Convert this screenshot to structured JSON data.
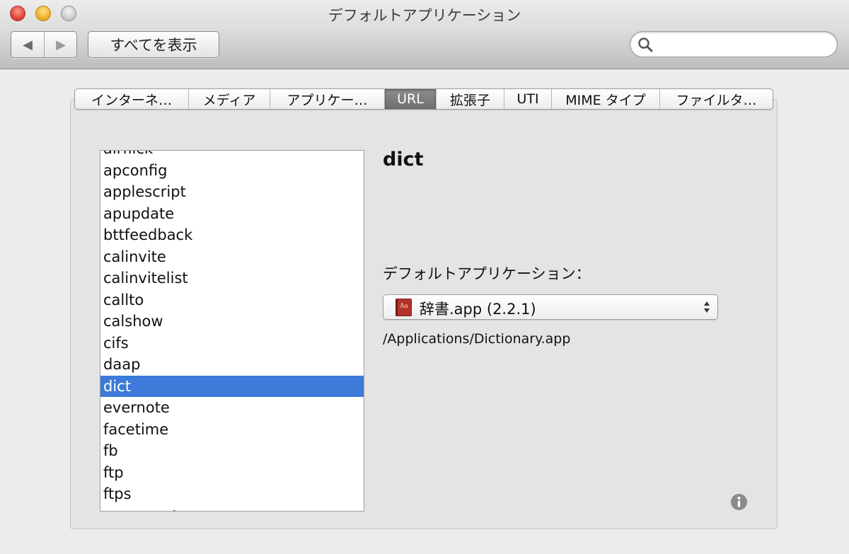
{
  "window": {
    "title": "デフォルトアプリケーション"
  },
  "toolbar": {
    "back_glyph": "◀",
    "forward_glyph": "▶",
    "show_all_label": "すべてを表示",
    "search": {
      "value": "",
      "placeholder": ""
    }
  },
  "tabs": [
    {
      "label": "インターネ…",
      "selected": false
    },
    {
      "label": "メディア",
      "selected": false
    },
    {
      "label": "アプリケー…",
      "selected": false
    },
    {
      "label": "URL",
      "selected": true
    },
    {
      "label": "拡張子",
      "selected": false
    },
    {
      "label": "UTI",
      "selected": false
    },
    {
      "label": "MIME タイプ",
      "selected": false
    },
    {
      "label": "ファイルタ…",
      "selected": false
    }
  ],
  "url_list": {
    "items": [
      "airflick",
      "apconfig",
      "applescript",
      "apupdate",
      "bttfeedback",
      "calinvite",
      "calinvitelist",
      "callto",
      "calshow",
      "cifs",
      "daap",
      "dict",
      "evernote",
      "facetime",
      "fb",
      "ftp",
      "ftps",
      "gamecenter"
    ],
    "selected_index": 11
  },
  "detail": {
    "scheme": "dict",
    "default_app_label": "デフォルトアプリケーション：",
    "app_popup": {
      "label": "辞書.app (2.2.1)",
      "icon": "dictionary-app-icon"
    },
    "path": "/Applications/Dictionary.app"
  },
  "colors": {
    "selection": "#3d7ad9",
    "selected_tab": "#7a7a7a"
  }
}
